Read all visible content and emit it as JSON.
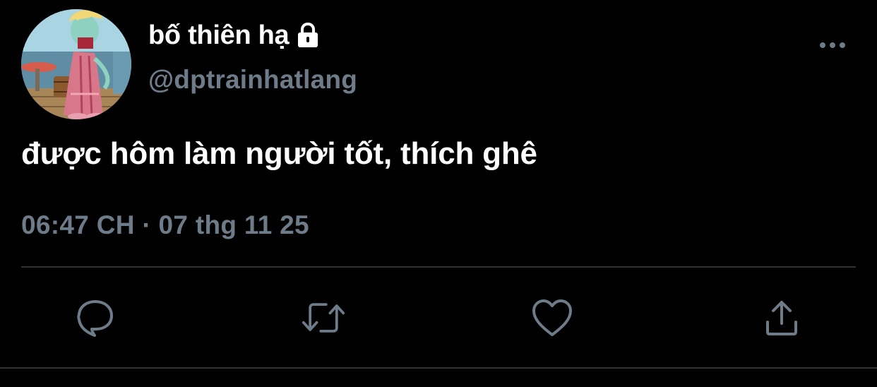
{
  "tweet": {
    "display_name": "bố thiên hạ",
    "handle": "@dptrainhatlang",
    "protected_icon": "lock-icon",
    "text": "được hôm làm người tốt, thích ghê",
    "timestamp": "06:47 CH · 07 thg 11 25"
  },
  "actions": [
    {
      "icon": "reply-icon"
    },
    {
      "icon": "retweet-icon"
    },
    {
      "icon": "like-icon"
    },
    {
      "icon": "share-icon"
    }
  ],
  "more_menu_icon": "more-options-icon",
  "colors": {
    "background": "#000000",
    "primary_text": "#ffffff",
    "secondary_text": "#6e7b88",
    "icon": "#6e7b88",
    "divider": "#2f3336"
  }
}
